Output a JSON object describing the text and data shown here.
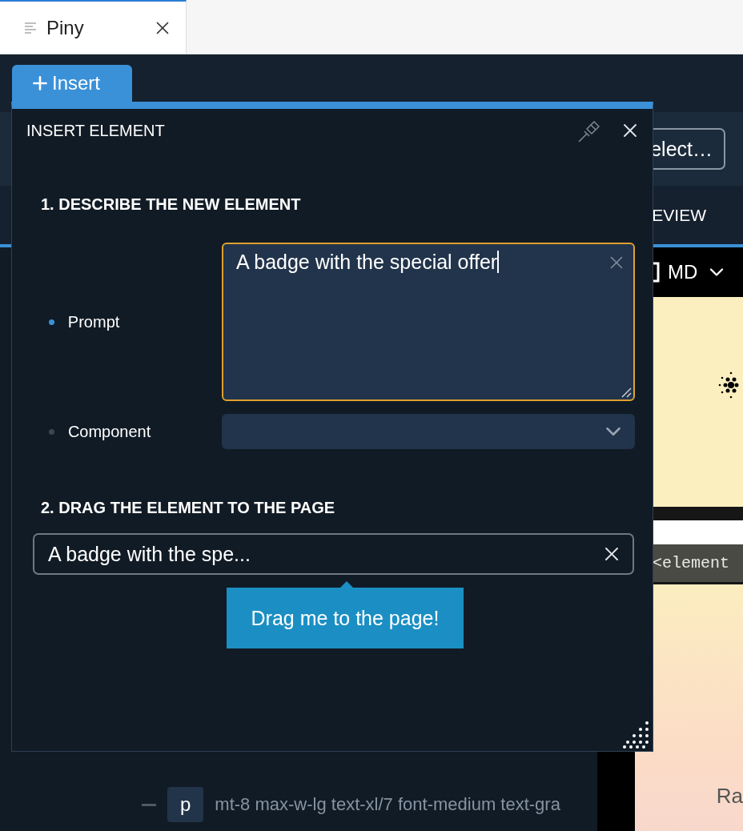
{
  "browser_tab": {
    "title": "Piny"
  },
  "insert_tab": {
    "label": "Insert"
  },
  "toolbar": {
    "select_button": "elect…"
  },
  "view_tab": {
    "label": "EVIEW"
  },
  "preview": {
    "breakpoint": "MD",
    "code_hint": "<element",
    "text": "Ra"
  },
  "tree": [
    {
      "tag": "p",
      "classes": "mt-8 max-w-lg text-xl/7 font-medium text-gra"
    }
  ],
  "dialog": {
    "title": "INSERT ELEMENT",
    "step1": {
      "heading": "1. DESCRIBE THE NEW ELEMENT",
      "fields": [
        {
          "kind": "textarea",
          "label": "Prompt",
          "focused": true,
          "value": "A badge with the special offer"
        },
        {
          "kind": "select",
          "label": "Component",
          "focused": false
        }
      ]
    },
    "step2": {
      "heading": "2. DRAG THE ELEMENT TO THE PAGE",
      "draggable": "A badge with the spe...",
      "tooltip": "Drag me to the page!"
    }
  }
}
